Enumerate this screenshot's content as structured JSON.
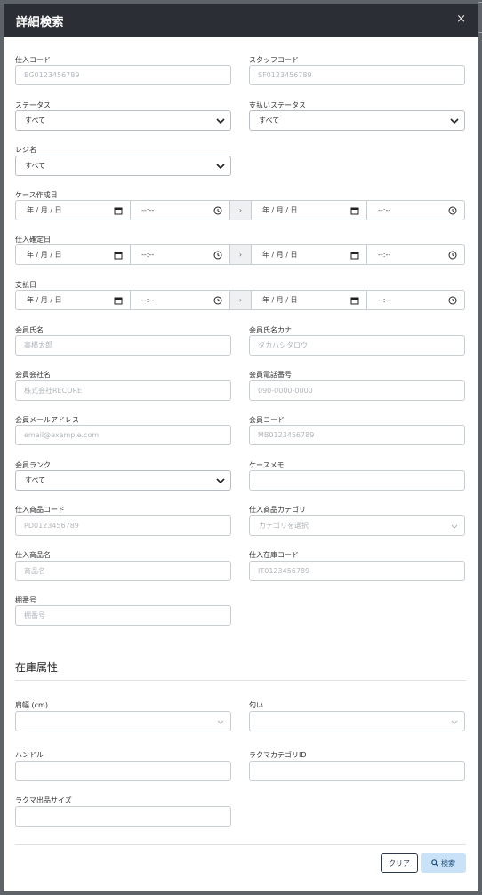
{
  "modal": {
    "title": "詳細検索",
    "close": "×"
  },
  "fields": {
    "purchase_code": {
      "label": "仕入コード",
      "placeholder": "BG0123456789"
    },
    "staff_code": {
      "label": "スタッフコード",
      "placeholder": "SF0123456789"
    },
    "status": {
      "label": "ステータス",
      "value": "すべて"
    },
    "payment_status": {
      "label": "支払いステータス",
      "value": "すべて"
    },
    "register_name": {
      "label": "レジ名",
      "value": "すべて"
    },
    "case_created": {
      "label": "ケース作成日",
      "date": "年 / 月 / 日",
      "time": "--:--",
      "separator": "›"
    },
    "purchase_confirmed": {
      "label": "仕入確定日",
      "date": "年 / 月 / 日",
      "time": "--:--",
      "separator": "›"
    },
    "payment_date": {
      "label": "支払日",
      "date": "年 / 月 / 日",
      "time": "--:--",
      "separator": "›"
    },
    "member_name": {
      "label": "会員氏名",
      "placeholder": "高橋太郎"
    },
    "member_name_kana": {
      "label": "会員氏名カナ",
      "placeholder": "タカハシタロウ"
    },
    "member_company": {
      "label": "会員会社名",
      "placeholder": "株式会社RECORE"
    },
    "member_phone": {
      "label": "会員電話番号",
      "placeholder": "090-0000-0000"
    },
    "member_email": {
      "label": "会員メールアドレス",
      "placeholder": "email@example.com"
    },
    "member_code": {
      "label": "会員コード",
      "placeholder": "MB0123456789"
    },
    "member_rank": {
      "label": "会員ランク",
      "value": "すべて"
    },
    "case_memo": {
      "label": "ケースメモ",
      "placeholder": ""
    },
    "product_code": {
      "label": "仕入商品コード",
      "placeholder": "PD0123456789"
    },
    "product_category": {
      "label": "仕入商品カテゴリ",
      "placeholder": "カテゴリを選択"
    },
    "product_name": {
      "label": "仕入商品名",
      "placeholder": "商品名"
    },
    "stock_code": {
      "label": "仕入在庫コード",
      "placeholder": "IT0123456789"
    },
    "shelf_number": {
      "label": "棚番号",
      "placeholder": "棚番号"
    }
  },
  "stock_attributes": {
    "title": "在庫属性",
    "shoulder_width": {
      "label": "肩幅 (cm)",
      "value": ""
    },
    "smell": {
      "label": "匂い",
      "value": ""
    },
    "handle": {
      "label": "ハンドル",
      "placeholder": ""
    },
    "rakuma_category": {
      "label": "ラクマカテゴリID",
      "placeholder": ""
    },
    "rakuma_size": {
      "label": "ラクマ出品サイズ",
      "placeholder": ""
    }
  },
  "buttons": {
    "clear": "クリア",
    "search": "検索"
  },
  "colors": {
    "header_bg": "#2b2f35",
    "search_btn_bg": "#c9e2f7",
    "backdrop": "#5e6369"
  }
}
